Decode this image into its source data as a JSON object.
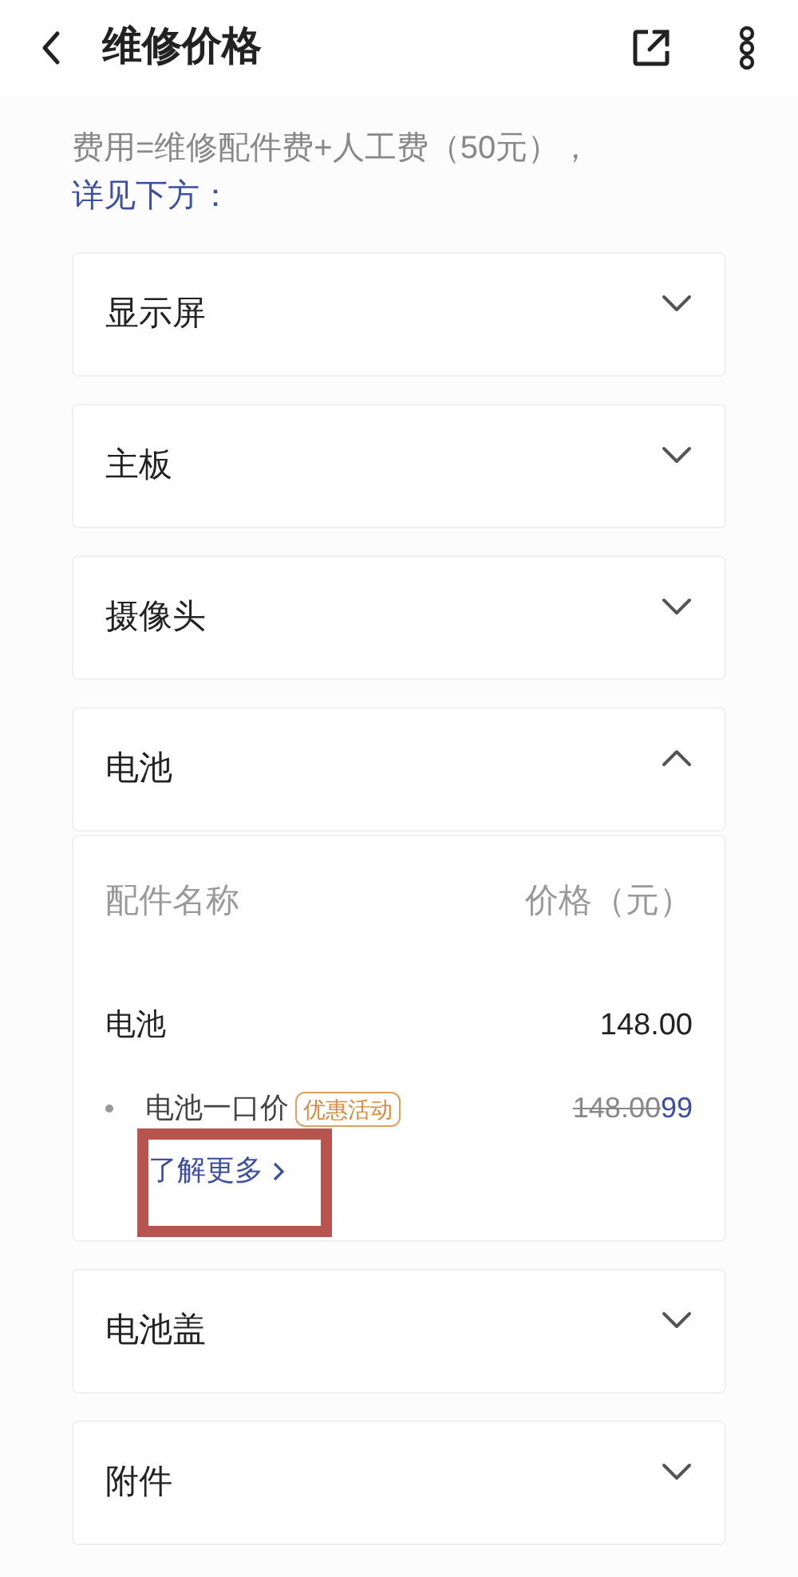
{
  "header": {
    "title": "维修价格"
  },
  "intro": {
    "text": "费用=维修配件费+人工费（50元），",
    "link": "详见下方："
  },
  "sections": [
    {
      "title": "显示屏",
      "expanded": false
    },
    {
      "title": "主板",
      "expanded": false
    },
    {
      "title": "摄像头",
      "expanded": false
    },
    {
      "title": "电池",
      "expanded": true,
      "table": {
        "columns": [
          "配件名称",
          "价格（元）"
        ],
        "rows": [
          {
            "name": "电池",
            "price": "148.00",
            "offers": [
              {
                "name": "电池一口价",
                "tag": "优惠活动",
                "old_price": "148.00",
                "price": "99",
                "link": "了解更多"
              }
            ]
          }
        ]
      }
    },
    {
      "title": "电池盖",
      "expanded": false
    },
    {
      "title": "附件",
      "expanded": false
    }
  ]
}
